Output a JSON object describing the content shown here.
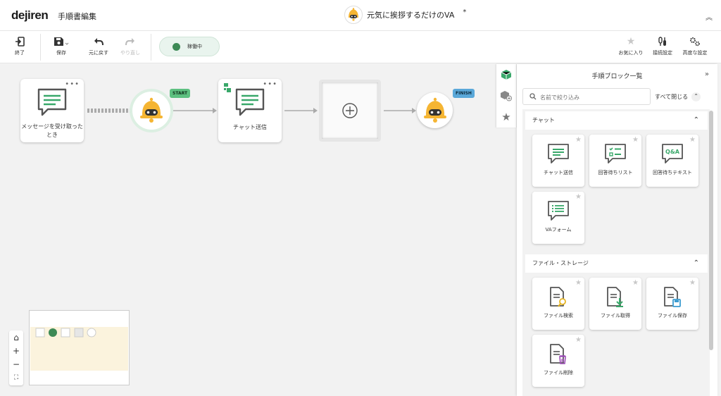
{
  "app": {
    "logo": "dejiren",
    "page_title": "手順書編集",
    "va_name": "元気に挨拶するだけのVA",
    "unsaved_mark": "*",
    "collapse_header": "︽"
  },
  "toolbar": {
    "exit_label": "終了",
    "save_label": "保存",
    "undo_label": "元に戻す",
    "redo_label": "やり直し",
    "status_label": "稼働中",
    "favorites_label": "お気に入り",
    "connection_label": "接続設定",
    "advanced_label": "高度な設定"
  },
  "canvas": {
    "trigger_node": {
      "label": "メッセージを受け取ったとき",
      "menu": "•••"
    },
    "start_tag": "START",
    "chat_node": {
      "label": "チャット送信",
      "menu": "•••"
    },
    "finish_tag": "FINISH"
  },
  "zoom": {
    "home": "⌂",
    "zoom_in": "+",
    "zoom_out": "−",
    "fit": "⛶"
  },
  "panel": {
    "title": "手順ブロック一覧",
    "expand": "»",
    "search_placeholder": "名前で絞り込み",
    "collapse_all": "すべて閉じる",
    "sections": [
      {
        "title": "チャット",
        "toggle": "⌃",
        "items": [
          {
            "label": "チャット送信",
            "icon": "chat-send-icon"
          },
          {
            "label": "回答待ちリスト",
            "icon": "answer-list-icon"
          },
          {
            "label": "回答待ちテキスト",
            "icon": "answer-text-icon"
          },
          {
            "label": "VAフォーム",
            "icon": "va-form-icon"
          }
        ]
      },
      {
        "title": "ファイル・ストレージ",
        "toggle": "⌃",
        "items": [
          {
            "label": "ファイル検索",
            "icon": "file-search-icon"
          },
          {
            "label": "ファイル取得",
            "icon": "file-download-icon"
          },
          {
            "label": "ファイル保存",
            "icon": "file-save-icon"
          },
          {
            "label": "ファイル削除",
            "icon": "file-delete-icon"
          }
        ]
      }
    ]
  },
  "colors": {
    "accent_green": "#3d8a56",
    "start_tag": "#5dc080",
    "finish_tag": "#5aa8d9",
    "bell": "#f5b533",
    "icon_green": "#39a86a"
  }
}
